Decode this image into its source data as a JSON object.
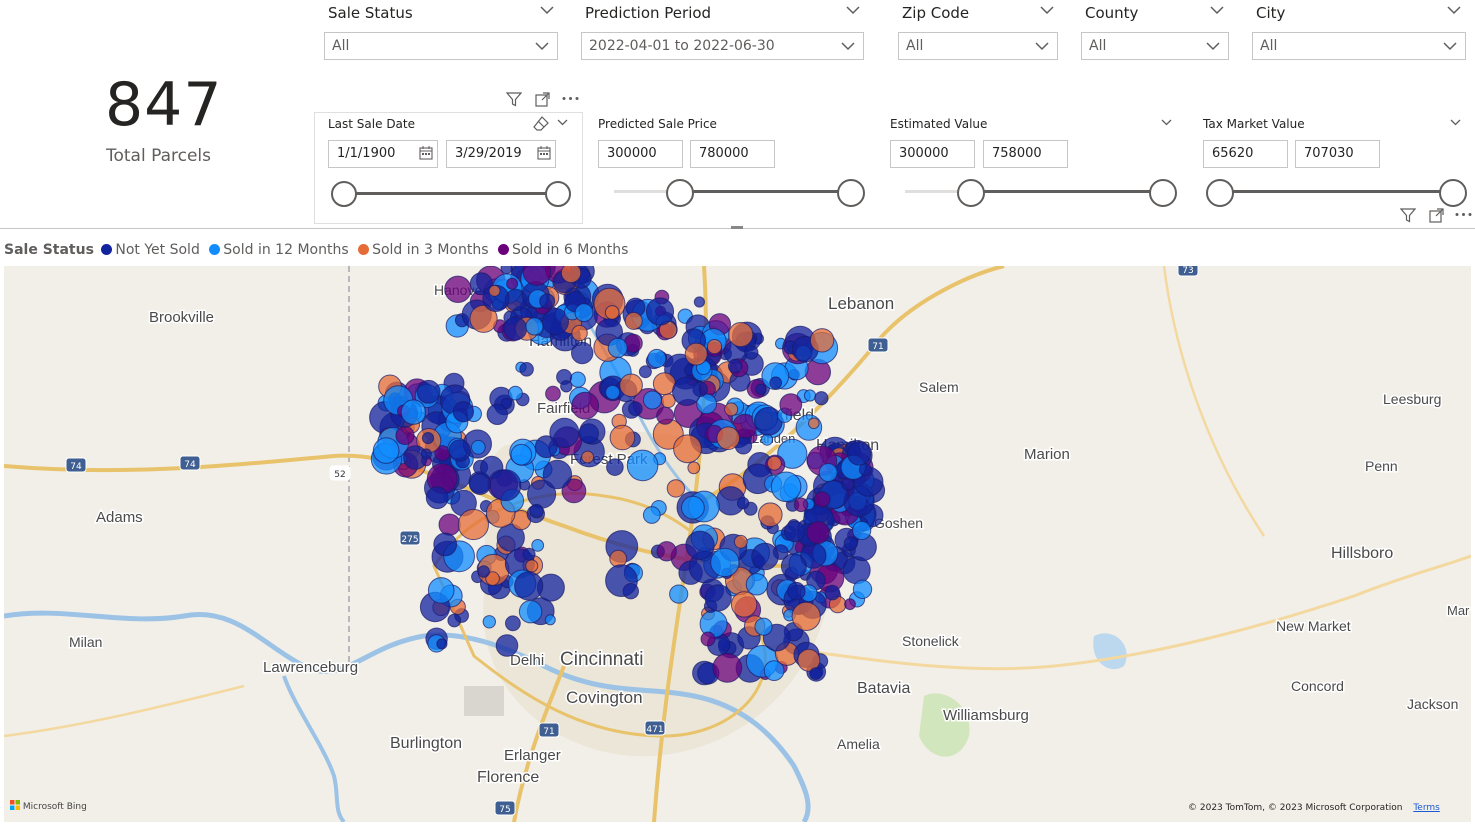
{
  "slicers": [
    {
      "title": "Sale Status",
      "value": "All"
    },
    {
      "title": "Prediction Period",
      "value": "2022-04-01 to 2022-06-30"
    },
    {
      "title": "Zip Code",
      "value": "All"
    },
    {
      "title": "County",
      "value": "All"
    },
    {
      "title": "City",
      "value": "All"
    }
  ],
  "kpi": {
    "value": "847",
    "label": "Total Parcels"
  },
  "range_slicers": {
    "last_sale_date": {
      "title": "Last Sale Date",
      "from": "1/1/1900",
      "to": "3/29/2019"
    },
    "predicted_sale_price": {
      "title": "Predicted Sale Price",
      "from": "300000",
      "to": "780000"
    },
    "estimated_value": {
      "title": "Estimated Value",
      "from": "300000",
      "to": "758000"
    },
    "tax_market_value": {
      "title": "Tax Market Value",
      "from": "65620",
      "to": "707030"
    }
  },
  "legend": {
    "title": "Sale Status",
    "items": [
      {
        "label": "Not Yet Sold",
        "color": "#12239e"
      },
      {
        "label": "Sold in 12 Months",
        "color": "#118dff"
      },
      {
        "label": "Sold in 3 Months",
        "color": "#e66c37"
      },
      {
        "label": "Sold in 6 Months",
        "color": "#6b007b"
      }
    ]
  },
  "map": {
    "places": [
      "Hanover",
      "Lebanon",
      "Brookville",
      "Hamilton",
      "Fairfield",
      "Salem",
      "Deerfield",
      "Landen",
      "Hamilton",
      "Leesburg",
      "Forest Park",
      "Marion",
      "Penn",
      "Adams",
      "Goshen",
      "Hillsboro",
      "Milan",
      "Lawrenceburg",
      "Delhi",
      "Cincinnati",
      "Covington",
      "Stonelick",
      "New Market",
      "Batavia",
      "Concord",
      "Williamsburg",
      "Jackson",
      "Burlington",
      "Erlanger",
      "Amelia",
      "Florence",
      "Mar"
    ],
    "shields": [
      "73",
      "71",
      "74",
      "74",
      "52",
      "275",
      "71",
      "75",
      "471"
    ],
    "attribution": "© 2023 TomTom, © 2023 Microsoft Corporation",
    "terms": "Terms",
    "provider": "Microsoft Bing"
  }
}
